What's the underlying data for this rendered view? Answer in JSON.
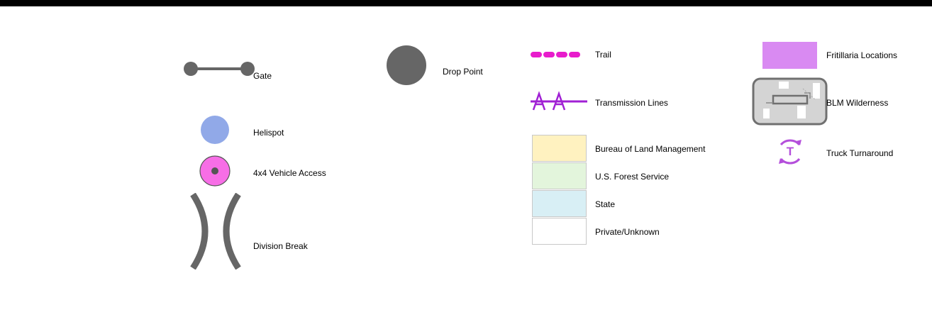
{
  "legend": {
    "gate": "Gate",
    "drop_point": "Drop Point",
    "trail": "Trail",
    "fritillaria": "Fritillaria Locations",
    "transmission_lines": "Transmission Lines",
    "blm_wilderness": "BLM Wilderness",
    "helispot": "Helispot",
    "blm": "Bureau of Land Management",
    "truck_turnaround": "Truck Turnaround",
    "vehicle_access": "4x4 Vehicle Access",
    "usfs": "U.S. Forest Service",
    "state": "State",
    "private": "Private/Unknown",
    "division_break": "Division Break",
    "turnaround_letter": "T"
  },
  "colors": {
    "symbol_gray": "#666666",
    "helispot": "#91a9e8",
    "vehicle_access": "#f76ee6",
    "trail": "#e81ccc",
    "transmission": "#a020d4",
    "fritillaria": "#d98af2",
    "blm_fill": "#fff2c0",
    "usfs_fill": "#e3f5dc",
    "state_fill": "#d8eff5",
    "private_fill": "#ffffff",
    "turnaround": "#b44fdb"
  }
}
